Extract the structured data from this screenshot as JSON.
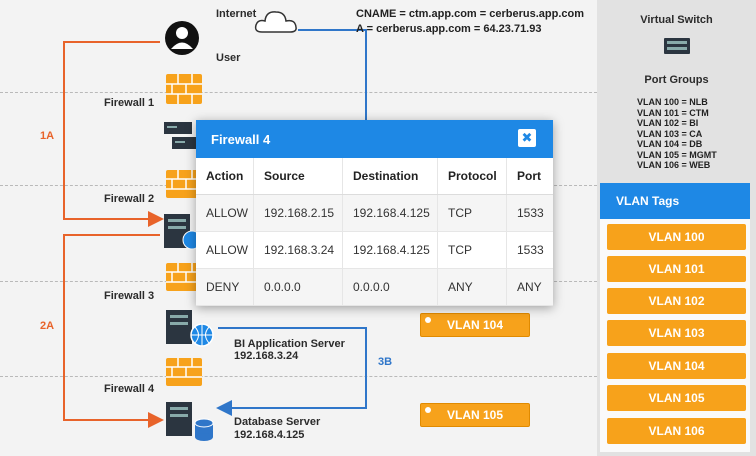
{
  "diagram": {
    "internet_label": "Internet",
    "user_label": "User",
    "dns": {
      "cname": "CNAME = ctm.app.com = cerberus.app.com",
      "a_record": "A = cerberus.app.com = 64.23.71.93"
    },
    "firewalls": [
      "Firewall 1",
      "Firewall 2",
      "Firewall 3",
      "Firewall 4"
    ],
    "path_labels": {
      "one_a": "1A",
      "two_a": "2A",
      "three_b": "3B"
    },
    "servers": {
      "bi_app": {
        "name": "BI Application Server",
        "ip": "192.168.3.24"
      },
      "database": {
        "name": "Database Server",
        "ip": "192.168.4.125"
      }
    },
    "badges": [
      "VLAN 104",
      "VLAN 105"
    ],
    "colors": {
      "orange_path": "#e8632a",
      "blue_path": "#2f76c9",
      "firewall_brick": "#f7a21b"
    }
  },
  "right_panel": {
    "virtual_switch_title": "Virtual Switch",
    "port_groups_title": "Port Groups",
    "port_groups": [
      "VLAN 100 = NLB",
      "VLAN 101 = CTM",
      "VLAN 102 = BI",
      "VLAN 103 = CA",
      "VLAN 104 = DB",
      "VLAN 105 = MGMT",
      "VLAN 106 = WEB"
    ],
    "vlan_tags_title": "VLAN Tags",
    "vlan_tags": [
      "VLAN 100",
      "VLAN 101",
      "VLAN 102",
      "VLAN 103",
      "VLAN 104",
      "VLAN 105",
      "VLAN 106"
    ],
    "accent": "#1e88e5",
    "tag_color": "#f7a21b"
  },
  "modal": {
    "title": "Firewall 4",
    "close_glyph": "✖",
    "columns": [
      "Action",
      "Source",
      "Destination",
      "Protocol",
      "Port"
    ],
    "rows": [
      [
        "ALLOW",
        "192.168.2.15",
        "192.168.4.125",
        "TCP",
        "1533"
      ],
      [
        "ALLOW",
        "192.168.3.24",
        "192.168.4.125",
        "TCP",
        "1533"
      ],
      [
        "DENY",
        "0.0.0.0",
        "0.0.0.0",
        "ANY",
        "ANY"
      ]
    ]
  }
}
